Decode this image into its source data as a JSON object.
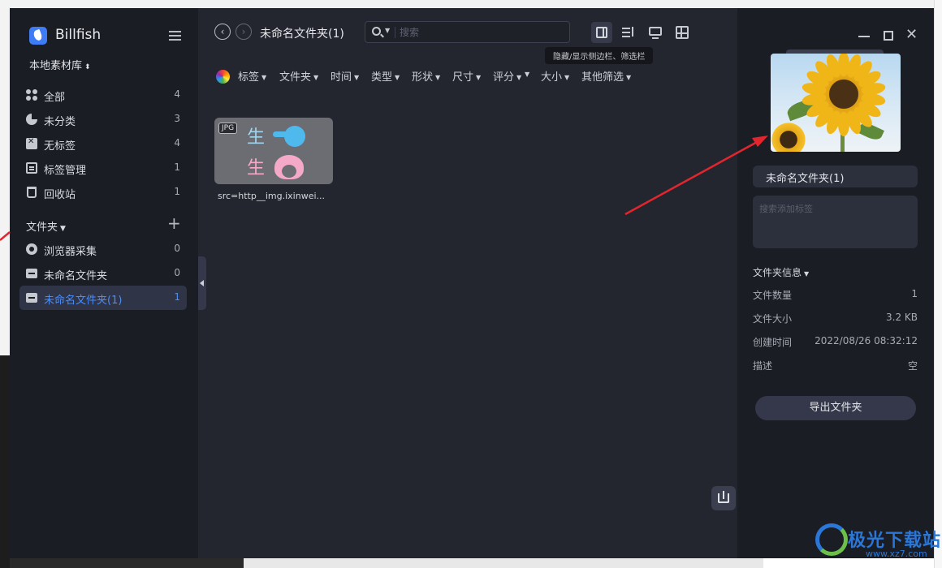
{
  "sidebar": {
    "app_name": "Billfish",
    "library": "本地素材库",
    "items": [
      {
        "label": "全部",
        "count": "4"
      },
      {
        "label": "未分类",
        "count": "3"
      },
      {
        "label": "无标签",
        "count": "4"
      },
      {
        "label": "标签管理",
        "count": "1"
      },
      {
        "label": "回收站",
        "count": "1"
      }
    ],
    "folders_title": "文件夹",
    "folders": [
      {
        "label": "浏览器采集",
        "count": "0"
      },
      {
        "label": "未命名文件夹",
        "count": "0"
      },
      {
        "label": "未命名文件夹(1)",
        "count": "1"
      }
    ],
    "active_color": "#4b8cf7"
  },
  "toolbar": {
    "folder_title": "未命名文件夹(1)",
    "search_placeholder": "搜索",
    "tooltip": "隐藏/显示侧边栏、筛选栏",
    "filters": [
      "标签",
      "文件夹",
      "时间",
      "类型",
      "形状",
      "尺寸",
      "评分",
      "",
      "大小",
      "其他筛选"
    ]
  },
  "content": {
    "items": [
      {
        "badge": "JPG",
        "name": "src=http__img.ixinwei...",
        "glyph_top": "生",
        "glyph_bottom": "生"
      }
    ]
  },
  "panel": {
    "name": "未命名文件夹(1)",
    "tag_placeholder": "搜索添加标签",
    "section_title": "文件夹信息",
    "info": [
      {
        "key": "文件数量",
        "value": "1"
      },
      {
        "key": "文件大小",
        "value": "3.2 KB"
      },
      {
        "key": "创建时间",
        "value": "2022/08/26 08:32:12"
      },
      {
        "key": "描述",
        "value": "空"
      }
    ],
    "export_label": "导出文件夹"
  },
  "watermark": {
    "text": "极光下载站",
    "url": "www.xz7.com"
  },
  "icons": {
    "sidebar": [
      "grid-icon",
      "pie-icon",
      "untagged-icon",
      "tag-manage-icon",
      "trash-icon"
    ],
    "folders": [
      "globe-icon",
      "folder-icon",
      "folder-icon"
    ]
  },
  "colors": {
    "window_bg": "#23252f",
    "sidebar_bg": "#1b1d25",
    "arrow": "#e3262d"
  }
}
